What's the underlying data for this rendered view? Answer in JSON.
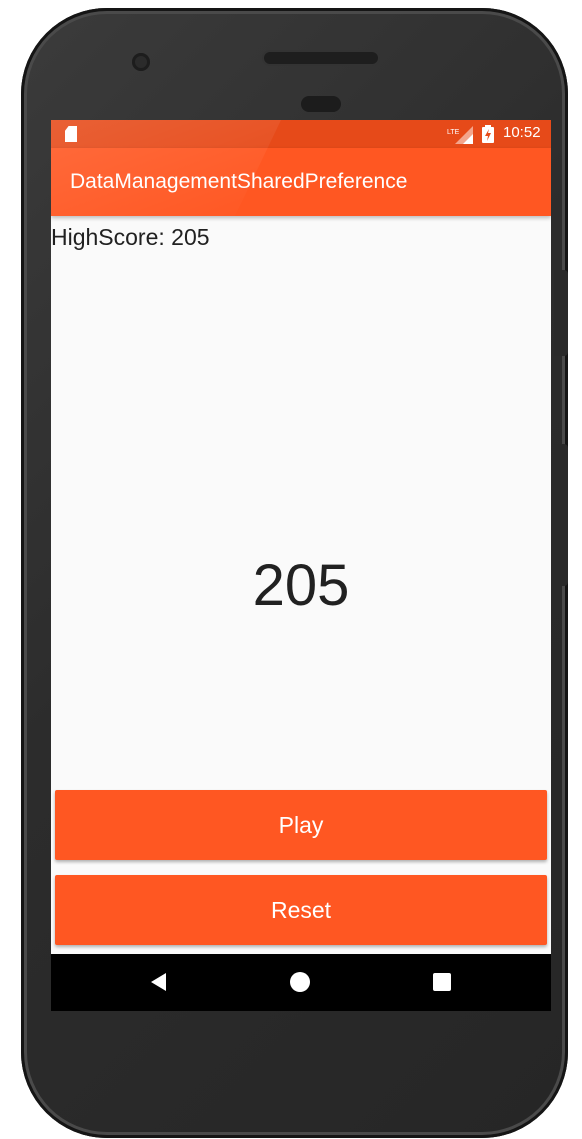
{
  "status_bar": {
    "time": "10:52",
    "network_label": "LTE",
    "icons": [
      "sd-card-icon",
      "lte-signal-icon",
      "battery-charging-icon"
    ],
    "color": "#e64a19"
  },
  "app_bar": {
    "title": "DataManagementSharedPreference",
    "color": "#ff5722"
  },
  "content": {
    "high_score_text": "HighScore: 205",
    "current_score": "205"
  },
  "buttons": {
    "play_label": "Play",
    "reset_label": "Reset",
    "color": "#ff5722"
  },
  "nav_bar": {
    "icons": [
      "back-icon",
      "home-icon",
      "recents-icon"
    ]
  }
}
